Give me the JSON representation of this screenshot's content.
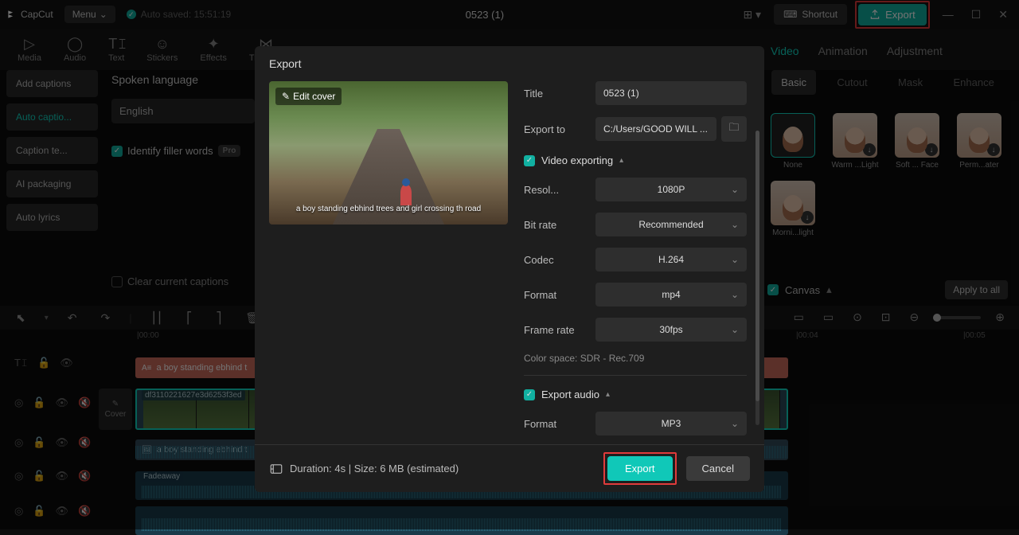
{
  "app": {
    "name": "CapCut",
    "menu": "Menu",
    "autosave": "Auto saved: 15:51:19",
    "project": "0523 (1)"
  },
  "header": {
    "shortcut": "Shortcut",
    "export": "Export"
  },
  "tools": {
    "media": "Media",
    "audio": "Audio",
    "text": "Text",
    "stickers": "Stickers",
    "effects": "Effects",
    "transit": "Transit..."
  },
  "rightTabs": {
    "video": "Video",
    "animation": "Animation",
    "adjustment": "Adjustment"
  },
  "rightSub": {
    "basic": "Basic",
    "cutout": "Cutout",
    "mask": "Mask",
    "enhance": "Enhance"
  },
  "presets": {
    "none": "None",
    "p1": "Warm ...Light",
    "p2": "Soft ... Face",
    "p3": "Perm...ater",
    "p4": "Morni...light"
  },
  "canvas": {
    "label": "Canvas",
    "applyAll": "Apply to all"
  },
  "side": {
    "addCaptions": "Add captions",
    "autoCaptions": "Auto captio...",
    "captionTe": "Caption te...",
    "aiPackaging": "AI packaging",
    "autoLyrics": "Auto lyrics"
  },
  "lang": {
    "title": "Spoken language",
    "value": "English",
    "filler": "Identify filler words",
    "pro": "Pro",
    "clear": "Clear current captions"
  },
  "ruler": {
    "t0": "00:00",
    "t1": "00:04",
    "t2": "00:05"
  },
  "timeline": {
    "cover": "Cover",
    "caption": "a boy standing ebhind t",
    "videoClip": "df3110221627e3d6253f3ed",
    "caption2": "a boy standing ebhind t",
    "fadeaway": "Fadeaway"
  },
  "modal": {
    "title": "Export",
    "editCover": "Edit cover",
    "captionOverlay": "a boy standing ebhind trees and girl crossing th road",
    "fields": {
      "titleLabel": "Title",
      "titleValue": "0523 (1)",
      "exportToLabel": "Export to",
      "exportToValue": "C:/Users/GOOD WILL ...",
      "sectionVideo": "Video exporting",
      "resolLabel": "Resol...",
      "resolValue": "1080P",
      "bitrateLabel": "Bit rate",
      "bitrateValue": "Recommended",
      "codecLabel": "Codec",
      "codecValue": "H.264",
      "formatLabel": "Format",
      "formatValue": "mp4",
      "framerateLabel": "Frame rate",
      "framerateValue": "30fps",
      "colorspace": "Color space: SDR - Rec.709",
      "sectionAudio": "Export audio",
      "audioFormatLabel": "Format",
      "audioFormatValue": "MP3"
    },
    "footer": {
      "duration": "Duration: 4s | Size: 6 MB (estimated)",
      "export": "Export",
      "cancel": "Cancel"
    }
  }
}
